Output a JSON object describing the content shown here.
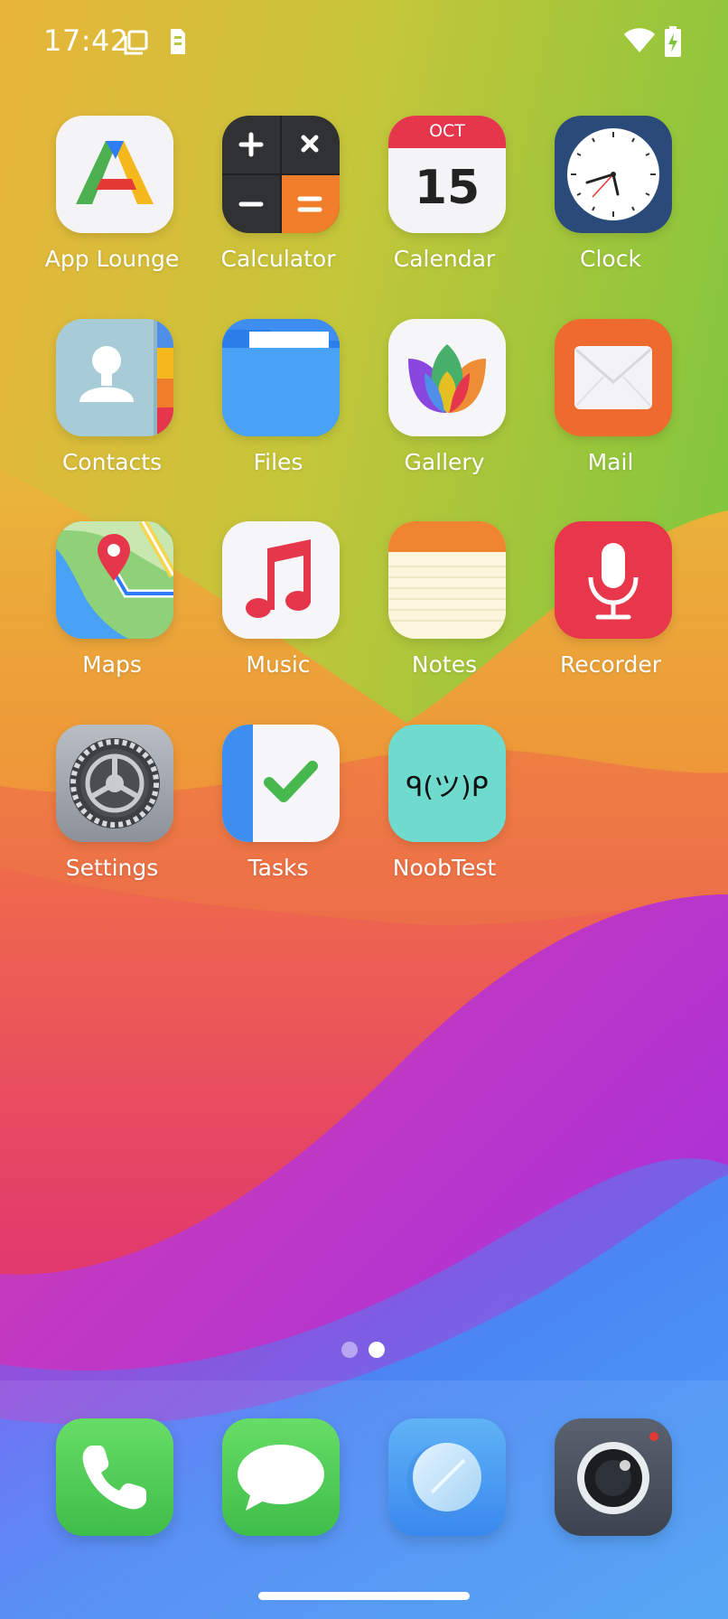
{
  "status_bar": {
    "time": "17:42",
    "icons": [
      "screenshot-icon",
      "sim-card-icon",
      "wifi-icon",
      "battery-charging-icon"
    ]
  },
  "apps": [
    {
      "label": "App Lounge",
      "icon": "app-lounge-icon"
    },
    {
      "label": "Calculator",
      "icon": "calculator-icon"
    },
    {
      "label": "Calendar",
      "icon": "calendar-icon",
      "month": "OCT",
      "day": "15"
    },
    {
      "label": "Clock",
      "icon": "clock-icon"
    },
    {
      "label": "Contacts",
      "icon": "contacts-icon"
    },
    {
      "label": "Files",
      "icon": "files-icon"
    },
    {
      "label": "Gallery",
      "icon": "gallery-icon"
    },
    {
      "label": "Mail",
      "icon": "mail-icon"
    },
    {
      "label": "Maps",
      "icon": "maps-icon"
    },
    {
      "label": "Music",
      "icon": "music-icon"
    },
    {
      "label": "Notes",
      "icon": "notes-icon"
    },
    {
      "label": "Recorder",
      "icon": "recorder-icon"
    },
    {
      "label": "Settings",
      "icon": "settings-icon"
    },
    {
      "label": "Tasks",
      "icon": "tasks-icon"
    },
    {
      "label": "NoobTest",
      "icon": "noobtest-icon",
      "glyph": "ᑫ(ツ)ᑭ"
    }
  ],
  "page_indicator": {
    "pages": 2,
    "current": 2
  },
  "dock": [
    {
      "name": "phone",
      "icon": "phone-icon"
    },
    {
      "name": "messages",
      "icon": "messages-icon"
    },
    {
      "name": "browser",
      "icon": "browser-icon"
    },
    {
      "name": "camera",
      "icon": "camera-icon"
    }
  ],
  "colors": {
    "wallpaper_top": "#8cc63f",
    "wallpaper_mid": "#e8b23a",
    "wallpaper_orange": "#ef7a35",
    "wallpaper_pink": "#e63f7a",
    "wallpaper_purple": "#b02de0",
    "wallpaper_blue": "#4a9cf0"
  }
}
